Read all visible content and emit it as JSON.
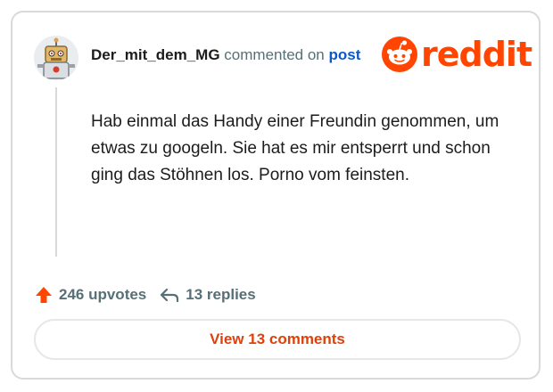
{
  "comment": {
    "username": "Der_mit_dem_MG",
    "action_text": "commented on",
    "post_link": "post",
    "body": "Hab einmal das Handy einer Freundin genommen, um etwas zu googeln. Sie hat es mir entsperrt und schon ging das Stöhnen los. Porno vom feinsten."
  },
  "brand": {
    "logo_text": "reddit",
    "color": "#ff4500"
  },
  "footer": {
    "upvotes": "246 upvotes",
    "replies": "13 replies",
    "view_button": "View 13 comments"
  },
  "icons": {
    "avatar": "robot-avatar-icon",
    "logo": "reddit-snoo-icon",
    "upvote": "upvote-arrow-icon",
    "reply": "reply-arrow-icon"
  },
  "colors": {
    "accent": "#ff4500",
    "link": "#0a58ca",
    "muted": "#576f76",
    "text": "#1c1c1c"
  }
}
